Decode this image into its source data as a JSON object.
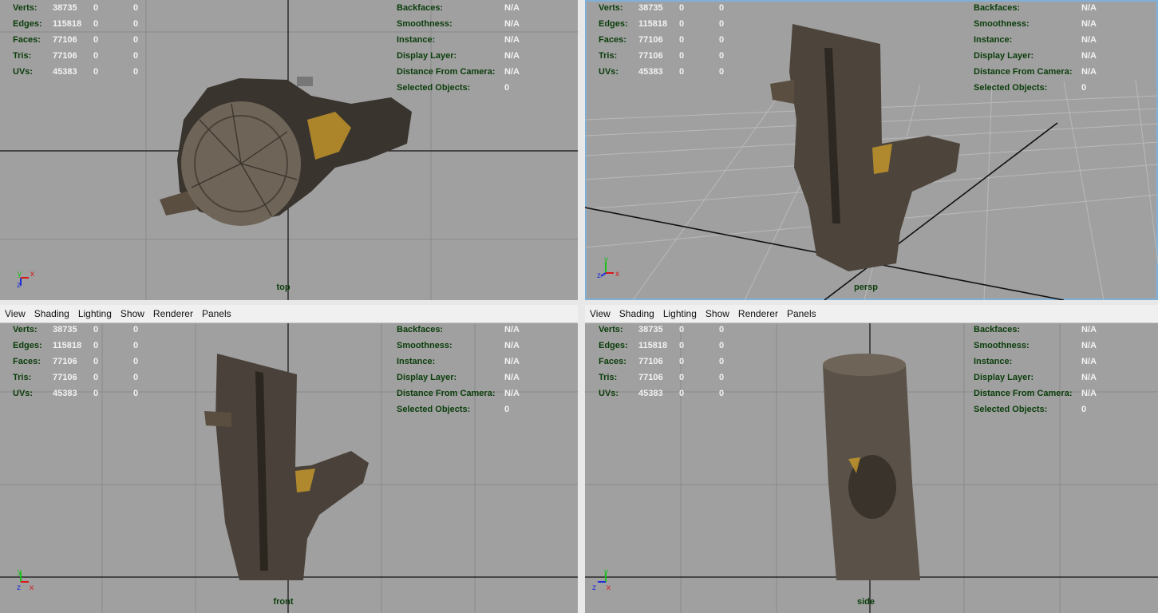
{
  "menu": [
    "View",
    "Shading",
    "Lighting",
    "Show",
    "Renderer",
    "Panels"
  ],
  "stats_left": [
    {
      "label": "Verts:",
      "v1": "38735",
      "v2": "0",
      "v3": "0"
    },
    {
      "label": "Edges:",
      "v1": "115818",
      "v2": "0",
      "v3": "0"
    },
    {
      "label": "Faces:",
      "v1": "77106",
      "v2": "0",
      "v3": "0"
    },
    {
      "label": "Tris:",
      "v1": "77106",
      "v2": "0",
      "v3": "0"
    },
    {
      "label": "UVs:",
      "v1": "45383",
      "v2": "0",
      "v3": "0"
    }
  ],
  "stats_right": [
    {
      "label": "Backfaces:",
      "value": "N/A"
    },
    {
      "label": "Smoothness:",
      "value": "N/A"
    },
    {
      "label": "Instance:",
      "value": "N/A"
    },
    {
      "label": "Display Layer:",
      "value": "N/A"
    },
    {
      "label": "Distance From Camera:",
      "value": "N/A"
    },
    {
      "label": "Selected Objects:",
      "value": "0"
    }
  ],
  "viewports": [
    {
      "camera": "top",
      "axes": [
        "x",
        "z"
      ]
    },
    {
      "camera": "persp",
      "axes": [
        "y",
        "z",
        "x"
      ]
    },
    {
      "camera": "front",
      "axes": [
        "y",
        "x"
      ]
    },
    {
      "camera": "side",
      "axes": [
        "y",
        "z"
      ]
    }
  ],
  "colors": {
    "viewport_bg": "#a0a0a0",
    "grid": "#8a8a8a",
    "hud_label": "#0a3d0a",
    "hud_value": "#f2f2f2",
    "active_border": "#7fb0d8",
    "axis_x": "#d81818",
    "axis_y": "#18c018",
    "axis_z": "#2030d8"
  }
}
